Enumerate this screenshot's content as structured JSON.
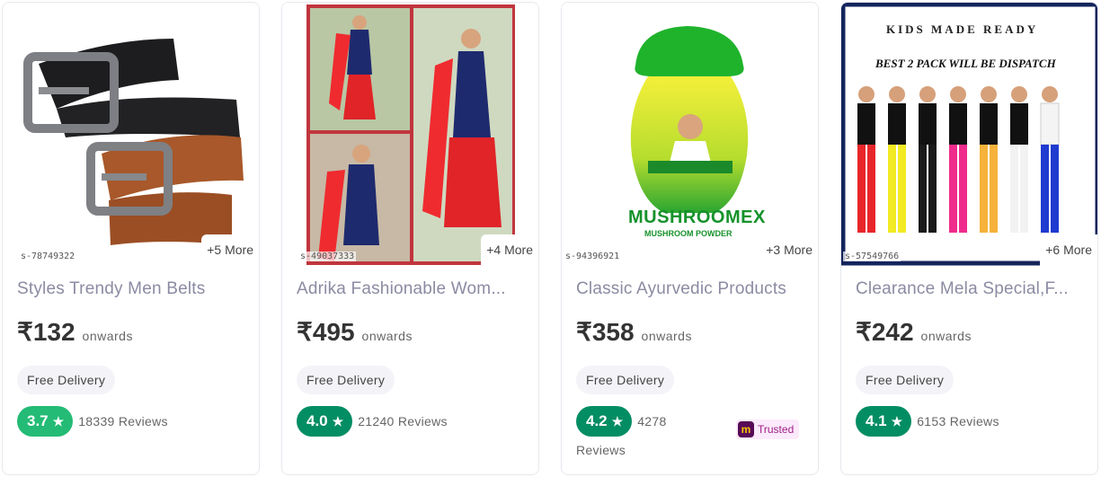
{
  "common": {
    "onwards": "onwards",
    "free_delivery": "Free Delivery"
  },
  "products": [
    {
      "title": "Styles Trendy Men Belts",
      "price": "₹132",
      "more": "+5 More",
      "pid": "s-78749322",
      "rating": "3.7",
      "reviews": "18339 Reviews"
    },
    {
      "title": "Adrika Fashionable Wom...",
      "price": "₹495",
      "more": "+4 More",
      "pid": "s-49037333",
      "rating": "4.0",
      "reviews": "21240 Reviews"
    },
    {
      "title": "Classic Ayurvedic Products",
      "price": "₹358",
      "more": "+3 More",
      "pid": "s-94396921",
      "rating": "4.2",
      "reviews_line1": "4278",
      "reviews_line2": "Reviews",
      "trusted": "Trusted",
      "image_brand": "MUSHROOMEX",
      "image_sub": "MUSHROOM POWDER"
    },
    {
      "title": "Clearance Mela Special,F...",
      "price": "₹242",
      "more": "+6 More",
      "pid": "s-57549766",
      "rating": "4.1",
      "reviews": "6153 Reviews",
      "image_heading": "KIDS MADE READY",
      "image_tag": "BEST 2 PACK WILL BE DISPATCH"
    }
  ],
  "colors": {
    "rating_light": "#23bb75",
    "rating_dark": "#038d63",
    "trusted_bg": "#fbeafb",
    "trusted_text": "#9f2089"
  }
}
